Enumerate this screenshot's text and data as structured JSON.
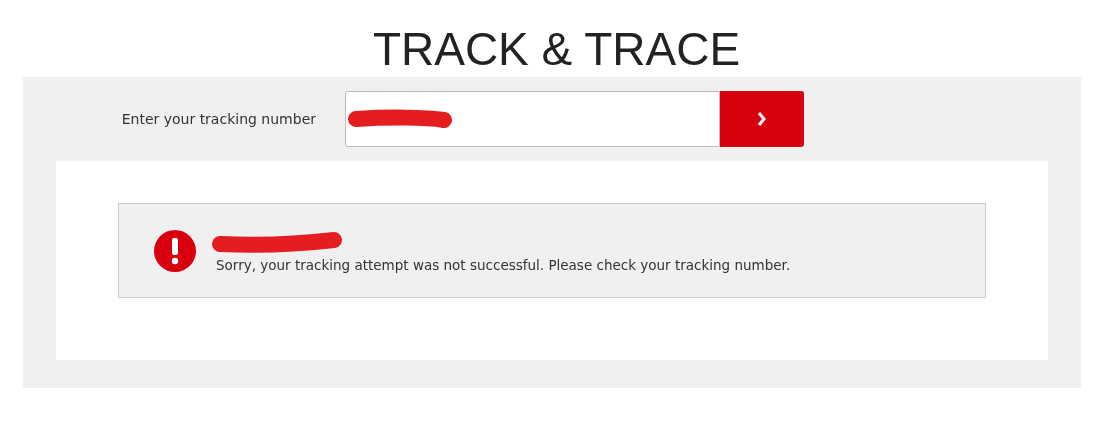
{
  "title": "TRACK & TRACE",
  "tracking": {
    "label": "Enter your tracking number"
  },
  "error": {
    "message": "Sorry, your tracking attempt was not successful. Please check your tracking number."
  }
}
